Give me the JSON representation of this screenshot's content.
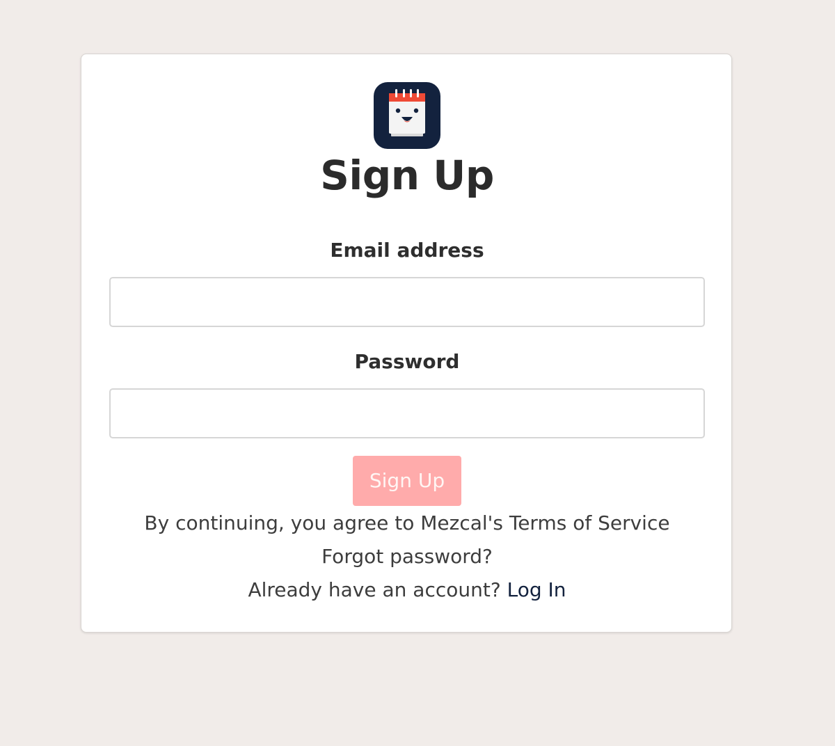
{
  "page": {
    "title": "Sign Up"
  },
  "form": {
    "email_label": "Email address",
    "email_value": "",
    "email_placeholder": "",
    "password_label": "Password",
    "password_value": "",
    "password_placeholder": "",
    "submit_label": "Sign Up"
  },
  "footer": {
    "terms_text": "By continuing, you agree to Mezcal's Terms of Service",
    "forgot_password": "Forgot password?",
    "have_account_text": "Already have an account?",
    "login_link": "Log In"
  },
  "icons": {
    "logo": "calendar-face-icon"
  },
  "colors": {
    "background": "#f1ece9",
    "card": "#ffffff",
    "button_disabled": "#ffabab",
    "login_link": "#13223e",
    "logo_dark": "#13223e",
    "logo_red": "#ef4a36"
  }
}
